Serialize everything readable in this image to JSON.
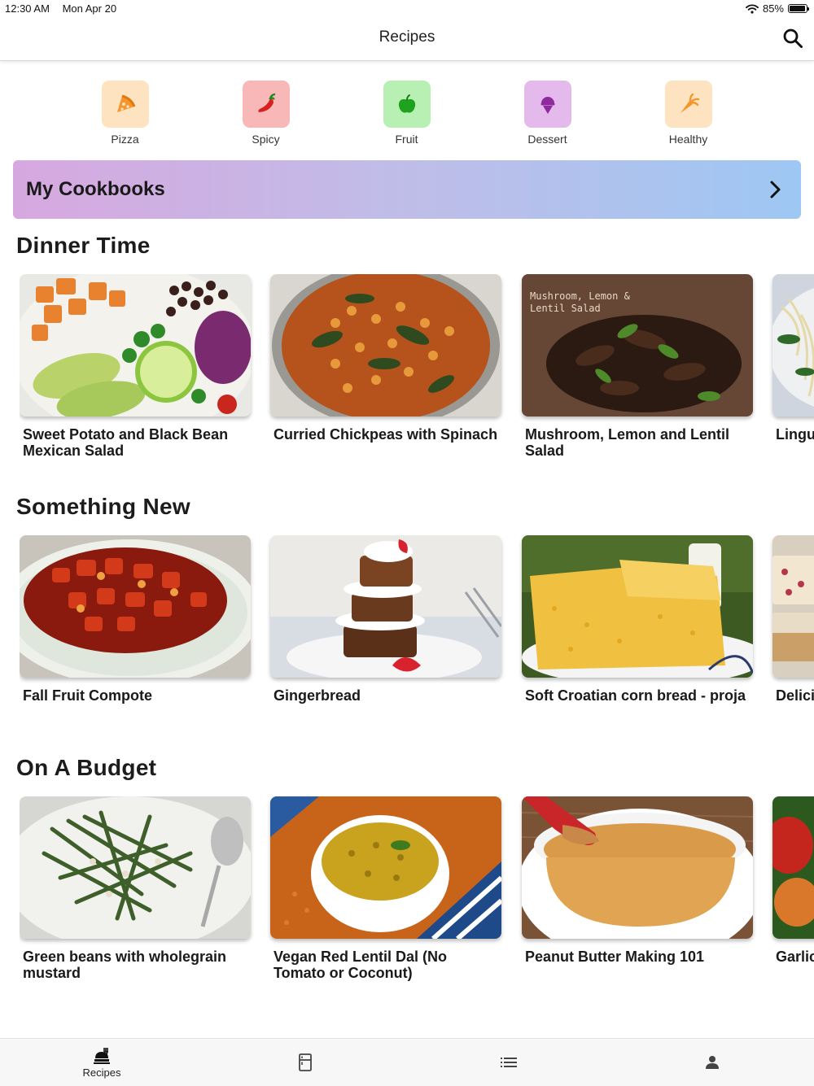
{
  "status_bar": {
    "time": "12:30 AM",
    "date": "Mon Apr 20",
    "battery": "85%",
    "wifi_icon": "wifi-icon",
    "battery_level": 0.85
  },
  "header": {
    "title": "Recipes",
    "search_icon": "search-icon"
  },
  "categories": [
    {
      "label": "Pizza",
      "icon": "pizza-icon",
      "bg": "#fde3c0",
      "color": "#f5962d"
    },
    {
      "label": "Spicy",
      "icon": "chili-pepper-icon",
      "bg": "#f9b8b8",
      "color": "#d92020"
    },
    {
      "label": "Fruit",
      "icon": "apple-icon",
      "bg": "#b8f0b4",
      "color": "#1fa31f"
    },
    {
      "label": "Dessert",
      "icon": "ice-cream-icon",
      "bg": "#e4b9ec",
      "color": "#8e2a9e"
    },
    {
      "label": "Healthy",
      "icon": "carrot-icon",
      "bg": "#fde3c0",
      "color": "#f5962d"
    }
  ],
  "cookbooks": {
    "label": "My Cookbooks",
    "icon": "chevron-right-icon"
  },
  "sections": [
    {
      "title": "Dinner Time",
      "recipes": [
        {
          "name": "Sweet Potato and Black Bean Mexican Salad"
        },
        {
          "name": "Curried Chickpeas with Spinach"
        },
        {
          "name": "Mushroom, Lemon and Lentil Salad",
          "image_text": "Mushroom, Lemon & Lentil Salad"
        },
        {
          "name": "Lingu White"
        }
      ]
    },
    {
      "title": "Something New",
      "recipes": [
        {
          "name": "Fall Fruit Compote"
        },
        {
          "name": "Gingerbread"
        },
        {
          "name": "Soft Croatian corn bread - proja"
        },
        {
          "name": "Delici"
        }
      ]
    },
    {
      "title": "On A Budget",
      "recipes": [
        {
          "name": "Green beans with wholegrain mustard"
        },
        {
          "name": "Vegan Red Lentil Dal (No Tomato or Coconut)"
        },
        {
          "name": "Peanut Butter Making 101"
        },
        {
          "name": "Garlic"
        }
      ]
    }
  ],
  "tab_bar": {
    "tabs": [
      {
        "label": "Recipes",
        "icon": "chef-hat-icon",
        "selected": true
      },
      {
        "label": "",
        "icon": "fridge-icon",
        "selected": false
      },
      {
        "label": "",
        "icon": "list-icon",
        "selected": false
      },
      {
        "label": "",
        "icon": "person-icon",
        "selected": false
      }
    ]
  }
}
